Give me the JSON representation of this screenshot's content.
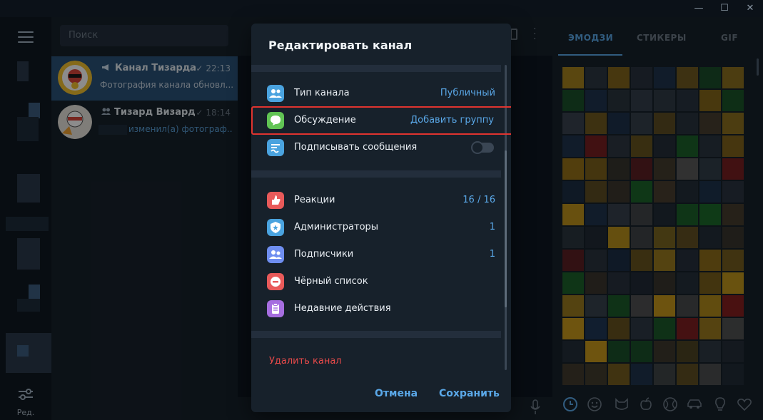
{
  "window": {
    "minimize": "—",
    "maximize": "☐",
    "close": "✕"
  },
  "sidebar": {
    "edit_label": "Ред."
  },
  "search": {
    "placeholder": "Поиск"
  },
  "chats": [
    {
      "name": "Канал Тизарда",
      "time": "22:13",
      "preview": "Фотография канала обновл..."
    },
    {
      "name": "Тизард Визард",
      "time": "18:14",
      "preview": "изменил(а) фотограф..."
    }
  ],
  "emoji_panel": {
    "tabs": [
      "ЭМОДЗИ",
      "СТИКЕРЫ",
      "GIF"
    ],
    "categories": [
      "clock-icon",
      "smile-icon",
      "cat-icon",
      "apple-icon",
      "ball-icon",
      "car-icon",
      "bulb-icon",
      "heart-icon"
    ]
  },
  "dialog": {
    "title": "Редактировать канал",
    "section1": [
      {
        "icon": "people-icon",
        "label": "Тип канала",
        "value": "Публичный",
        "color": "#4aa3df"
      },
      {
        "icon": "discussion-icon",
        "label": "Обсуждение",
        "value": "Добавить группу",
        "color": "#61c454"
      },
      {
        "icon": "signature-icon",
        "label": "Подписывать сообщения",
        "value": "",
        "color": "#4aa3df"
      }
    ],
    "section2": [
      {
        "icon": "reactions-icon",
        "label": "Реакции",
        "value": "16 / 16",
        "color": "#e85a5a"
      },
      {
        "icon": "admins-icon",
        "label": "Администраторы",
        "value": "1",
        "color": "#4aa3df"
      },
      {
        "icon": "subscribers-icon",
        "label": "Подписчики",
        "value": "1",
        "color": "#6f8ef0"
      },
      {
        "icon": "blacklist-icon",
        "label": "Чёрный список",
        "value": "",
        "color": "#e85a5a"
      },
      {
        "icon": "recent-actions-icon",
        "label": "Недавние действия",
        "value": "",
        "color": "#a66ee0"
      }
    ],
    "delete_label": "Удалить канал",
    "cancel_label": "Отмена",
    "save_label": "Сохранить"
  },
  "colors": {
    "accent": "#5aa8e8",
    "danger": "#e84a4a",
    "highlight": "#e0342f"
  }
}
